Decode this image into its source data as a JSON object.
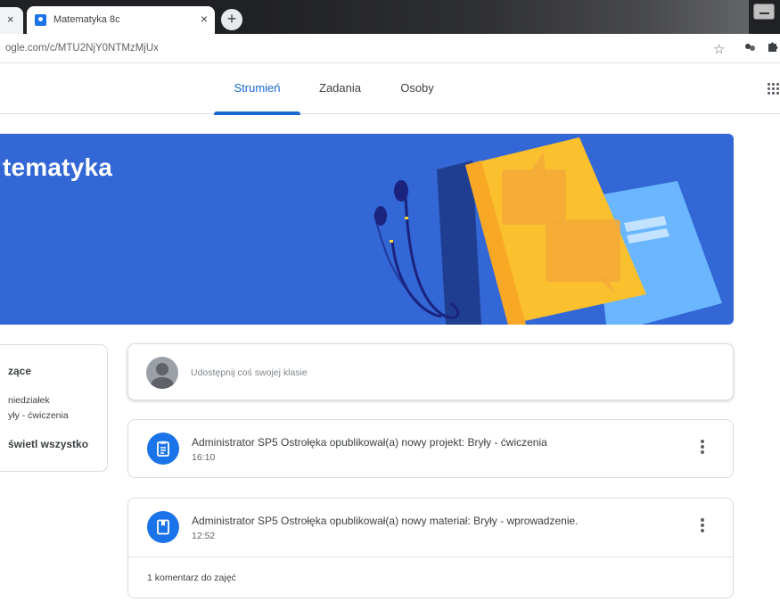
{
  "browser": {
    "tab_title": "Matematyka 8c",
    "tab_close": "×",
    "prev_tab_close": "×",
    "new_tab": "+",
    "url": "ogle.com/c/MTU2NjY0NTMzMjUx",
    "bookmark_icon": "star-icon",
    "extension_icons": [
      "extension-icon",
      "puzzle-icon"
    ]
  },
  "nav": {
    "tabs": [
      {
        "label": "Strumień",
        "active": true
      },
      {
        "label": "Zadania",
        "active": false
      },
      {
        "label": "Osoby",
        "active": false
      }
    ],
    "apps_icon": "apps-grid-icon"
  },
  "banner": {
    "class_title": "tematyka",
    "background": "#3367d6"
  },
  "upcoming": {
    "heading": "zące",
    "items": [
      "niedziałek",
      "yły - ćwiczenia"
    ],
    "view_all": "świetl wszystko"
  },
  "share": {
    "placeholder": "Udostępnij coś swojej klasie"
  },
  "posts": [
    {
      "title": "Administrator SP5 Ostrołęka opublikował(a) nowy projekt: Bryły - ćwiczenia",
      "time": "16:10",
      "icon": "assignment-icon"
    },
    {
      "title": "Administrator SP5 Ostrołęka opublikował(a) nowy materiał: Bryły - wprowadzenie.",
      "time": "12:52",
      "icon": "material-icon",
      "comments": "1 komentarz do zajęć"
    }
  ],
  "colors": {
    "accent": "#1967d2",
    "post_icon_bg": "#1a73e8",
    "book_yellow": "#fbc02d"
  }
}
